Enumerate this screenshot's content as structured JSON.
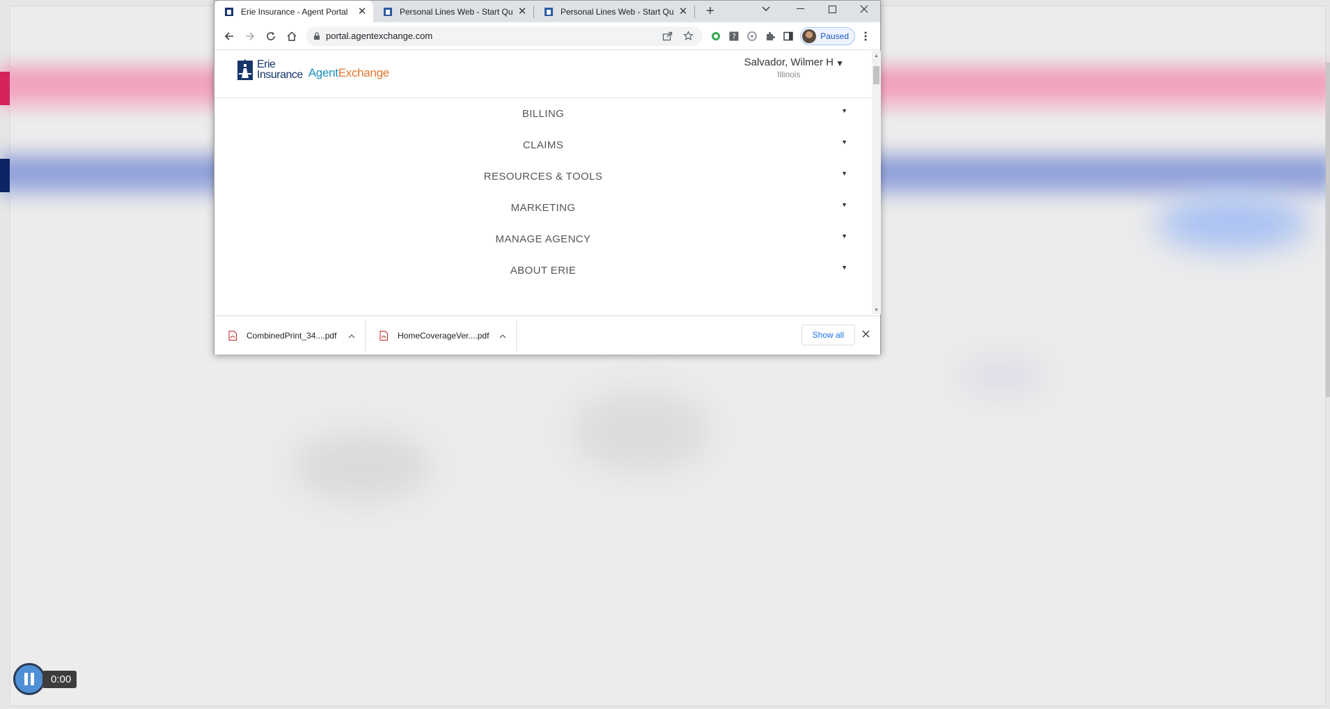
{
  "browser": {
    "tabs": [
      {
        "title": "Erie Insurance - Agent Portal",
        "active": true
      },
      {
        "title": "Personal Lines Web - Start Quo",
        "active": false
      },
      {
        "title": "Personal Lines Web - Start Quo",
        "active": false
      }
    ],
    "url": "portal.agentexchange.com",
    "profile_status": "Paused"
  },
  "site": {
    "logo_erie_line1": "Erie",
    "logo_erie_line2": "Insurance",
    "logo_agent": "Agent",
    "logo_exchange": "Exchange",
    "user_name": "Salvador, Wilmer H",
    "user_state": "Illinois",
    "nav": [
      {
        "label": "BILLING"
      },
      {
        "label": "CLAIMS"
      },
      {
        "label": "RESOURCES & TOOLS"
      },
      {
        "label": "MARKETING"
      },
      {
        "label": "MANAGE AGENCY"
      },
      {
        "label": "ABOUT ERIE"
      }
    ]
  },
  "downloads": {
    "items": [
      {
        "name": "CombinedPrint_34....pdf"
      },
      {
        "name": "HomeCoverageVer....pdf"
      }
    ],
    "show_all": "Show all"
  },
  "video": {
    "time": "0:00"
  },
  "colors": {
    "erie_navy": "#16356b",
    "agent_blue": "#1a8fbf",
    "exchange_orange": "#e0772b",
    "link_blue": "#1a73e8"
  }
}
